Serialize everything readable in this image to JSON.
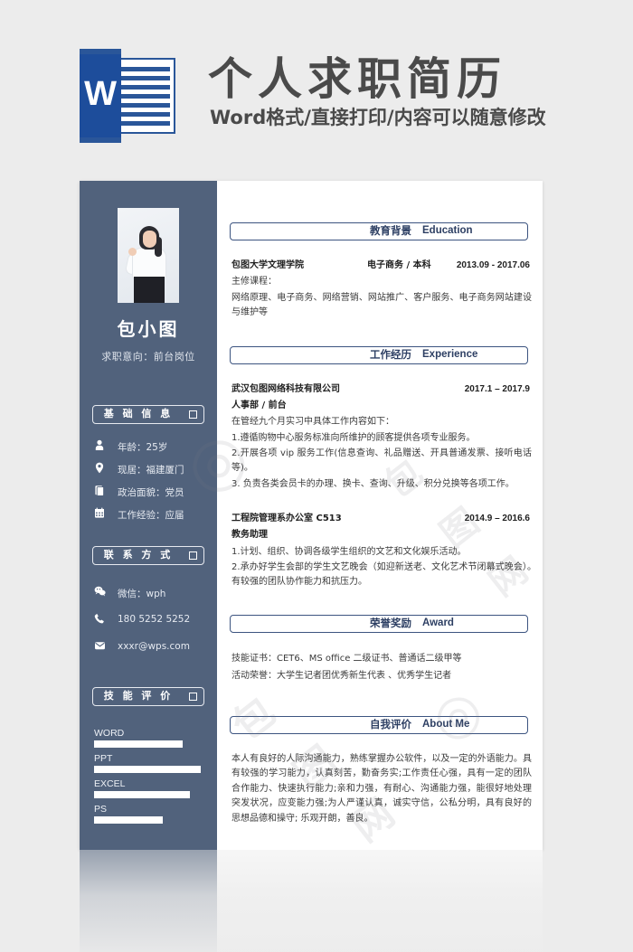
{
  "banner": {
    "word_icon_letter": "W",
    "title": "个人求职简历",
    "subtitle": "Word格式/直接打印/内容可以随意修改"
  },
  "sidebar": {
    "name": "包小图",
    "intent": "求职意向：前台岗位",
    "basic_section": "基 础 信 息",
    "basic_items": [
      {
        "icon": "person-icon",
        "text": "年龄：25岁"
      },
      {
        "icon": "location-pin-icon",
        "text": "现居：福建厦门"
      },
      {
        "icon": "document-icon",
        "text": "政治面貌：党员"
      },
      {
        "icon": "calendar-icon",
        "text": "工作经验：应届"
      }
    ],
    "contact_section": "联 系 方 式",
    "contact_items": [
      {
        "icon": "wechat-icon",
        "text": "微信：wph"
      },
      {
        "icon": "phone-icon",
        "text": "180 5252 5252"
      },
      {
        "icon": "mail-icon",
        "text": "xxxr@wps.com"
      }
    ],
    "skills_section": "技 能 评 价",
    "skills": [
      {
        "label": "WORD",
        "value": 80
      },
      {
        "label": "PPT",
        "value": 97
      },
      {
        "label": "EXCEL",
        "value": 87
      },
      {
        "label": "PS",
        "value": 62
      }
    ]
  },
  "main": {
    "education": {
      "cn": "教育背景",
      "en": "Education",
      "school": "包图大学文理学院",
      "major": "电子商务 / 本科",
      "date": "2013.09 - 2017.06",
      "courses_label": "主修课程：",
      "courses": "网络原理、电子商务、网络营销、网站推广、客户服务、电子商务网站建设与维护等"
    },
    "experience": {
      "cn": "工作经历",
      "en": "Experience",
      "jobs": [
        {
          "company": "武汉包图网络科技有限公司",
          "date": "2017.1 – 2017.9",
          "role": "人事部 / 前台",
          "intro": "在管经九个月实习中具体工作内容如下：",
          "duties": [
            "1.遵循购物中心服务标准向所维护的顾客提供各项专业服务。",
            "2.开展各项 vip 服务工作(信息查询、礼品赠送、开具普通发票、接听电话等)。",
            "3. 负责各类会员卡的办理、换卡、查询、升级、积分兑换等各项工作。"
          ]
        },
        {
          "company": "工程院管理系办公室 C513",
          "date": "2014.9 – 2016.6",
          "role": "教务助理",
          "intro": "",
          "duties": [
            "1.计划、组织、协调各级学生组织的文艺和文化娱乐活动。",
            "2.承办好学生会部的学生文艺晚会（如迎新送老、文化艺术节闭幕式晚会）。　有较强的团队协作能力和抗压力。"
          ]
        }
      ]
    },
    "award": {
      "cn": "荣誉奖励",
      "en": "Award",
      "lines": [
        "技能证书：CET6、MS office 二级证书、普通话二级甲等",
        "活动荣誉：大学生记者团优秀新生代表 、优秀学生记者"
      ]
    },
    "about": {
      "cn": "自我评价",
      "en": "About Me",
      "text": "本人有良好的人际沟通能力，熟练掌握办公软件，以及一定的外语能力。具有较强的学习能力，认真刻苦，勤奋务实;工作责任心强，具有一定的团队合作能力、快速执行能力;亲和力强，有耐心、沟通能力强，能很好地处理突发状况，应变能力强;为人严谨认真，诚实守信，公私分明，具有良好的思想品德和操守; 乐观开朗，善良。"
    }
  },
  "colors": {
    "sidebar": "#51627c",
    "accent": "#2d3f63",
    "page_bg": "#ffffff",
    "canvas": "#ececec"
  },
  "watermark": "包图网"
}
